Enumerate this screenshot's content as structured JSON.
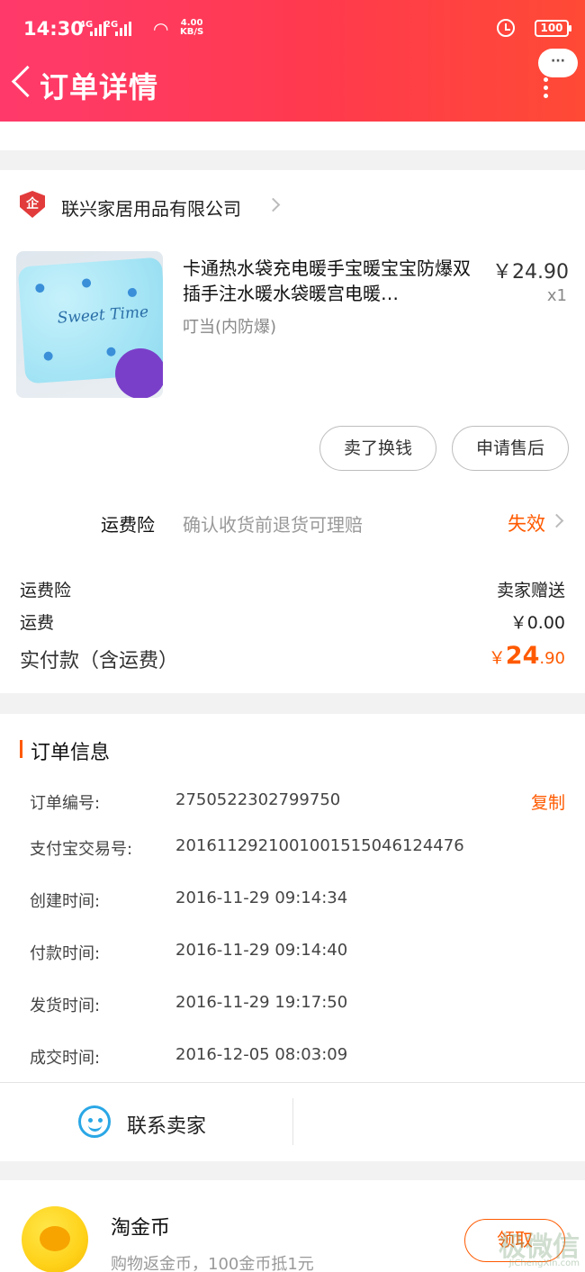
{
  "status_bar": {
    "time": "14:30",
    "net1": "4G",
    "net2": "2G",
    "speed_top": "4.00",
    "speed_bottom": "KB/S",
    "battery": "100"
  },
  "header": {
    "title": "订单详情",
    "more_label": "···"
  },
  "shop": {
    "name": "联兴家居用品有限公司",
    "logo_text": "企"
  },
  "product": {
    "title": "卡通热水袋充电暖手宝暖宝宝防爆双插手注水暖水袋暖宫电暖…",
    "variant": "叮当(内防爆)",
    "price": "￥24.90",
    "quantity": "x1",
    "image_text": "Sweet Time"
  },
  "actions": {
    "sell_label": "卖了换钱",
    "after_sale_label": "申请售后"
  },
  "insurance": {
    "label": "运费险",
    "desc": "确认收货前退货可理赔",
    "status": "失效"
  },
  "costs": {
    "insurance_label": "运费险",
    "insurance_value": "卖家赠送",
    "shipping_label": "运费",
    "shipping_value": "￥0.00",
    "paid_label": "实付款（含运费）",
    "paid_currency": "￥",
    "paid_int": "24",
    "paid_dec": ".90"
  },
  "order_info": {
    "title": "订单信息",
    "copy_label": "复制",
    "rows": [
      {
        "key": "订单编号:",
        "value": "2750522302799750"
      },
      {
        "key": "支付宝交易号:",
        "value": "2016112921001001515046124476"
      },
      {
        "key": "创建时间:",
        "value": "2016-11-29 09:14:34"
      },
      {
        "key": "付款时间:",
        "value": "2016-11-29 09:14:40"
      },
      {
        "key": "发货时间:",
        "value": "2016-11-29 19:17:50"
      },
      {
        "key": "成交时间:",
        "value": "2016-12-05 08:03:09"
      }
    ]
  },
  "contact": {
    "label": "联系卖家"
  },
  "coins": {
    "title": "淘金币",
    "desc": "购物返金币，100金币抵1元",
    "claim_label": "领取"
  },
  "watermark": {
    "main": "极微信",
    "sub": "JiChengXin.com"
  },
  "colors": {
    "accent": "#ff5a00",
    "header_start": "#ff3a6b",
    "header_end": "#ff4a35",
    "contact": "#2aa7e6"
  }
}
